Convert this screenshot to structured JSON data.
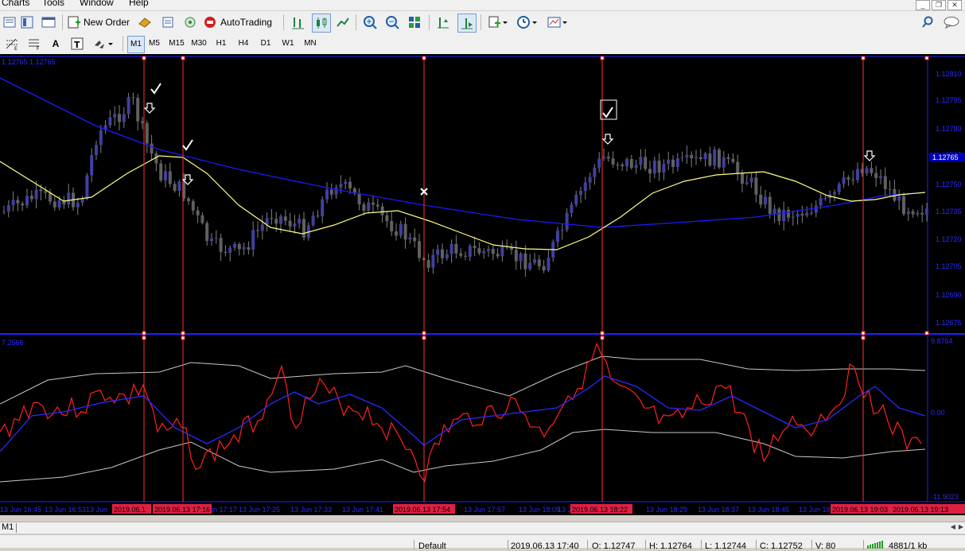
{
  "menu": [
    "Charts",
    "Tools",
    "Window",
    "Help"
  ],
  "toolbar": {
    "new_order": "New Order",
    "autotrading": "AutoTrading"
  },
  "timeframes": [
    "M1",
    "M5",
    "M15",
    "M30",
    "H1",
    "H4",
    "D1",
    "W1",
    "MN"
  ],
  "chart": {
    "info_label": "1.12765 1.12765",
    "price_axis": [
      "1.12810",
      "1.12795",
      "1.12780",
      "1.12765",
      "1.12750",
      "1.12735",
      "1.12720",
      "1.12705",
      "1.12690",
      "1.12675"
    ],
    "current_price": "1.12765",
    "osc_top": "7.2566",
    "osc_right_top": "9.8764",
    "osc_mid": "0.00",
    "osc_bottom": "-11.9023",
    "time_axis": [
      "13 Jun 16:45",
      "13 Jun 16:53",
      "13 Jun",
      "13 Jun 17:17",
      "13 Jun 17:25",
      "13 Jun 17:33",
      "13 Jun 17:41",
      "13 Jun 17:57",
      "13 Jun 18:05",
      "13 Jun",
      "13 Jun 18:29",
      "13 Jun 18:37",
      "13 Jun 18:45",
      "13 Jun 18:"
    ],
    "time_flags": [
      "2019.06.1",
      "2019.06.13 17:16",
      "2019.06.13 17:54",
      "2019.06.13 18:22",
      "2019.06.13 19:03",
      "2019.06.13 19:13"
    ],
    "colors": {
      "ma_blue": "#1a1aff",
      "ma_yellow": "#ffff80",
      "osc_red": "#ff2020",
      "vline": "#ff3030",
      "axis": "#2020ff"
    }
  },
  "tab_label": "M1",
  "status": {
    "profile": "Default",
    "datetime": "2019.06.13 17:40",
    "open": "O: 1.12747",
    "high": "H: 1.12764",
    "low": "L: 1.12744",
    "close": "C: 1.12752",
    "volume": "V: 80",
    "traffic": "4881/1 kb"
  }
}
